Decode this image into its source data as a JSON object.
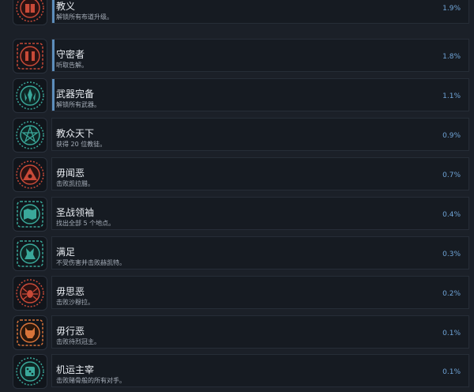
{
  "achievements": [
    {
      "title": "教义",
      "desc": "解锁所有布道升级。",
      "pct": "1.9%",
      "icon": "scroll-shield-icon",
      "theme": "red",
      "accent": true
    },
    {
      "title": "守密者",
      "desc": "听取告解。",
      "pct": "1.8%",
      "icon": "confessional-hands-icon",
      "theme": "red",
      "accent": true
    },
    {
      "title": "武器完备",
      "desc": "解锁所有武器。",
      "pct": "1.1%",
      "icon": "weapons-icon",
      "theme": "teal",
      "accent": true
    },
    {
      "title": "教众天下",
      "desc": "获得 20 位教徒。",
      "pct": "0.9%",
      "icon": "pentagram-icon",
      "theme": "teal",
      "accent": false
    },
    {
      "title": "毋闻恶",
      "desc": "击败凯拉腊。",
      "pct": "0.7%",
      "icon": "pyramid-eye-icon",
      "theme": "red",
      "accent": false
    },
    {
      "title": "圣战领袖",
      "desc": "找出全部 5 个地点。",
      "pct": "0.4%",
      "icon": "map-icon",
      "theme": "teal",
      "accent": false
    },
    {
      "title": "满足",
      "desc": "不受伤害并击败赫凯特。",
      "pct": "0.3%",
      "icon": "creature-icon",
      "theme": "teal",
      "accent": false
    },
    {
      "title": "毋思恶",
      "desc": "击败沙穆拉。",
      "pct": "0.2%",
      "icon": "spider-icon",
      "theme": "red",
      "accent": false
    },
    {
      "title": "毋行恶",
      "desc": "击败待烈冠主。",
      "pct": "0.1%",
      "icon": "beast-icon",
      "theme": "orange",
      "accent": false
    },
    {
      "title": "机运主宰",
      "desc": "击败赌骨般的所有对手。",
      "pct": "0.1%",
      "icon": "dice-icon",
      "theme": "teal",
      "accent": false
    }
  ],
  "colors": {
    "red": "#c94a38",
    "teal": "#3aa89a",
    "orange": "#d8743a",
    "percent": "#6fa3d6"
  }
}
